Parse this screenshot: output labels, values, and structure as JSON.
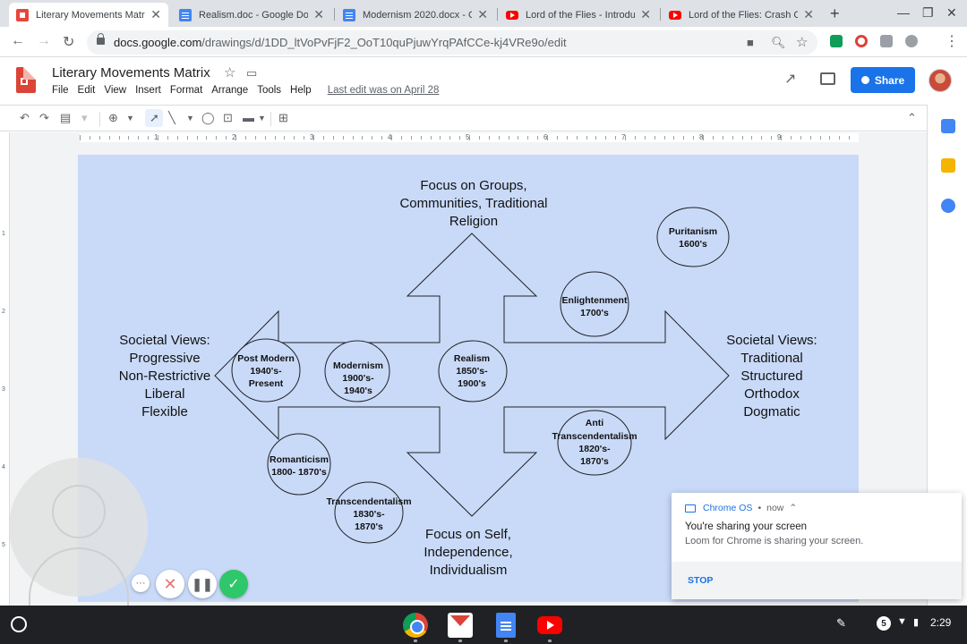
{
  "browser": {
    "tabs": [
      {
        "title": "Literary Movements Matri",
        "icon": "drawings-icon",
        "active": true
      },
      {
        "title": "Realism.doc - Google Doc",
        "icon": "docs-icon",
        "active": false
      },
      {
        "title": "Modernism 2020.docx - G",
        "icon": "docs-icon",
        "active": false
      },
      {
        "title": "Lord of the Flies - Introdu",
        "icon": "youtube-icon",
        "active": false
      },
      {
        "title": "Lord of the Flies: Crash C",
        "icon": "youtube-icon",
        "active": false
      }
    ],
    "url_host": "docs.google.com",
    "url_path": "/drawings/d/1DD_ltVoPvFjF2_OoT10quPjuwYrqPAfCCe-kj4VRe9o/edit"
  },
  "app": {
    "title": "Literary Movements Matrix",
    "menu": [
      "File",
      "Edit",
      "View",
      "Insert",
      "Format",
      "Arrange",
      "Tools",
      "Help"
    ],
    "last_edit": "Last edit was on April 28",
    "share_label": "Share"
  },
  "ruler": {
    "h_numbers": [
      "1",
      "2",
      "3",
      "4",
      "5",
      "6",
      "7",
      "8",
      "9"
    ],
    "v_numbers": [
      "1",
      "2",
      "3",
      "4",
      "5"
    ]
  },
  "diagram": {
    "top_label": [
      "Focus on Groups,",
      "Communities, Traditional",
      "Religion"
    ],
    "bottom_label": [
      "Focus on Self,",
      "Independence,",
      "Individualism"
    ],
    "left_label": [
      "Societal Views:",
      "Progressive",
      "Non-Restrictive",
      "Liberal",
      "Flexible"
    ],
    "right_label": [
      "Societal Views:",
      "Traditional",
      "Structured",
      "Orthodox",
      "Dogmatic"
    ],
    "movements": [
      {
        "lines": [
          "Puritanism",
          "1600's"
        ]
      },
      {
        "lines": [
          "Enlightenment",
          "1700's"
        ]
      },
      {
        "lines": [
          "Post Modern",
          "1940's-",
          "Present"
        ]
      },
      {
        "lines": [
          "Modernism",
          "1900's-",
          "1940's"
        ]
      },
      {
        "lines": [
          "Realism",
          "1850's-",
          "1900's"
        ]
      },
      {
        "lines": [
          "Anti",
          "Transcendentalism",
          "1820's-",
          "1870's"
        ]
      },
      {
        "lines": [
          "Romanticism",
          "1800- 1870's"
        ]
      },
      {
        "lines": [
          "Transcendentalism",
          "1830's-",
          "1870's"
        ]
      }
    ]
  },
  "notification": {
    "source": "Chrome OS",
    "time": "now",
    "title": "You're sharing your screen",
    "message": "Loom for Chrome is sharing your screen.",
    "action": "STOP"
  },
  "shelf": {
    "notification_count": "5",
    "time": "2:29"
  },
  "colors": {
    "canvas": "#c9daf8",
    "share_button": "#1a73e8",
    "loom_confirm": "#2ec76a"
  }
}
